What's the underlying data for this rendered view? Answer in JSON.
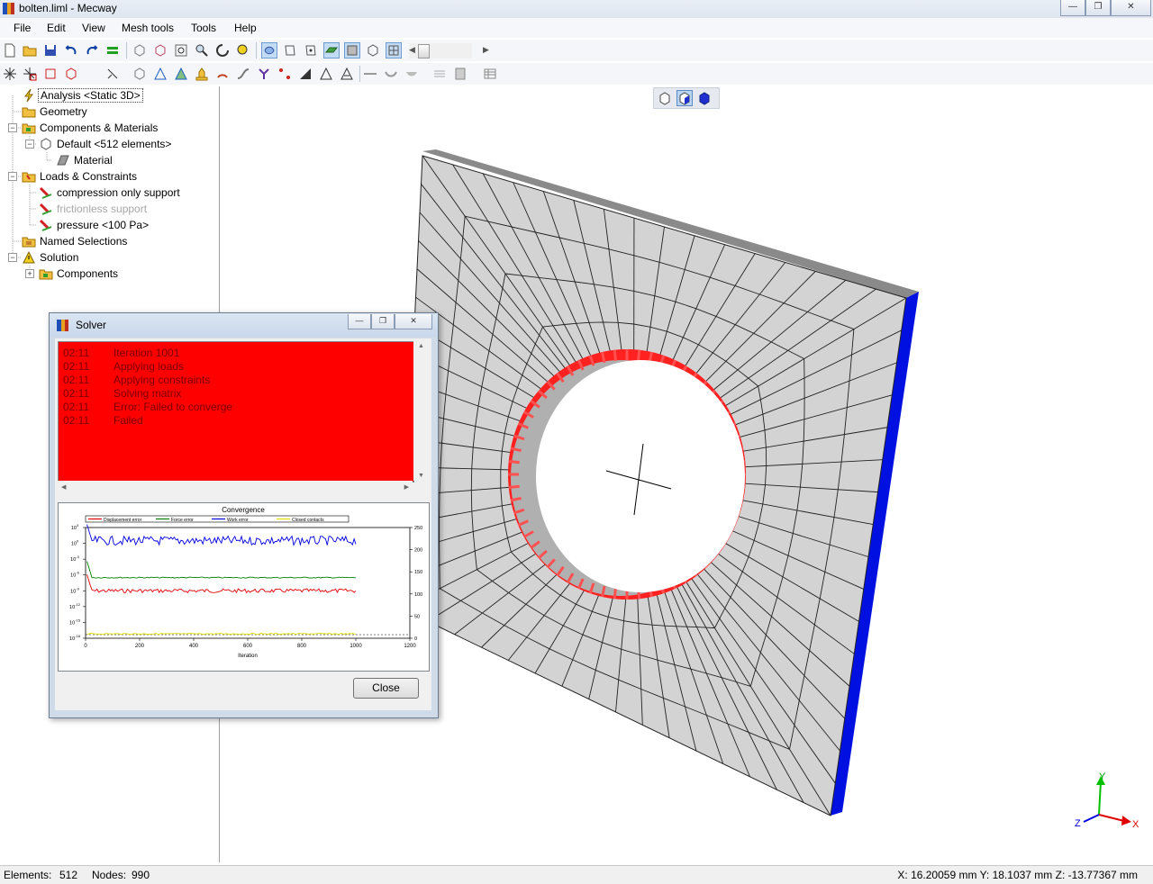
{
  "window": {
    "title": "bolten.liml - Mecway"
  },
  "menu": [
    "File",
    "Edit",
    "View",
    "Mesh tools",
    "Tools",
    "Help"
  ],
  "tree": {
    "analysis": "Analysis <Static 3D>",
    "geometry": "Geometry",
    "components": "Components & Materials",
    "default": "Default <512 elements>",
    "material": "Material",
    "loads": "Loads & Constraints",
    "load1": "compression only support",
    "load2": "frictionless support",
    "load3": "pressure <100 Pa>",
    "named": "Named Selections",
    "solution": "Solution",
    "sol_components": "Components"
  },
  "solver": {
    "title": "Solver",
    "log": [
      {
        "time": "02:11",
        "msg": "Iteration 1001"
      },
      {
        "time": "02:11",
        "msg": "Applying loads"
      },
      {
        "time": "02:11",
        "msg": "Applying constraints"
      },
      {
        "time": "02:11",
        "msg": "Solving matrix"
      },
      {
        "time": "02:11",
        "msg": "Error: Failed to converge"
      },
      {
        "time": "02:11",
        "msg": "Failed"
      }
    ],
    "close_label": "Close"
  },
  "chart_data": {
    "type": "line",
    "title": "Convergence",
    "xlabel": "Iteration",
    "ylabel": "",
    "xlim": [
      0,
      1200
    ],
    "x_ticks": [
      "0",
      "200",
      "400",
      "600",
      "800",
      "1000",
      "1200"
    ],
    "y_left_log_exponents": [
      3,
      0,
      -3,
      -6,
      -9,
      -12,
      -15,
      -18
    ],
    "y_right_ticks": [
      "0",
      "50",
      "100",
      "150",
      "200",
      "250"
    ],
    "ylim_right": [
      0,
      250
    ],
    "log_scale_left": true,
    "grid": false,
    "legend": "top",
    "series": [
      {
        "name": "Displacement error",
        "color": "#e00000",
        "log10_value": -9,
        "x_end": 1000
      },
      {
        "name": "Force error",
        "color": "#008000",
        "log10_value": -6.5,
        "x_end": 1000
      },
      {
        "name": "Work error",
        "color": "#0000e0",
        "log10_value": 0.5,
        "x_end": 1000
      },
      {
        "name": "Closed contacts",
        "color": "#e0e000",
        "right_value": 10,
        "x_end": 1000
      }
    ]
  },
  "status": {
    "elements_label": "Elements:",
    "elements": "512",
    "nodes_label": "Nodes:",
    "nodes": "990",
    "coords": "X: 16.20059 mm Y: 18.1037 mm Z: -13.77367 mm"
  },
  "axes": {
    "x": "X",
    "y": "Y",
    "z": "Z"
  },
  "colors": {
    "face": "#d3d3d3",
    "edge": "#0000dd",
    "pressure": "#ff2020"
  }
}
